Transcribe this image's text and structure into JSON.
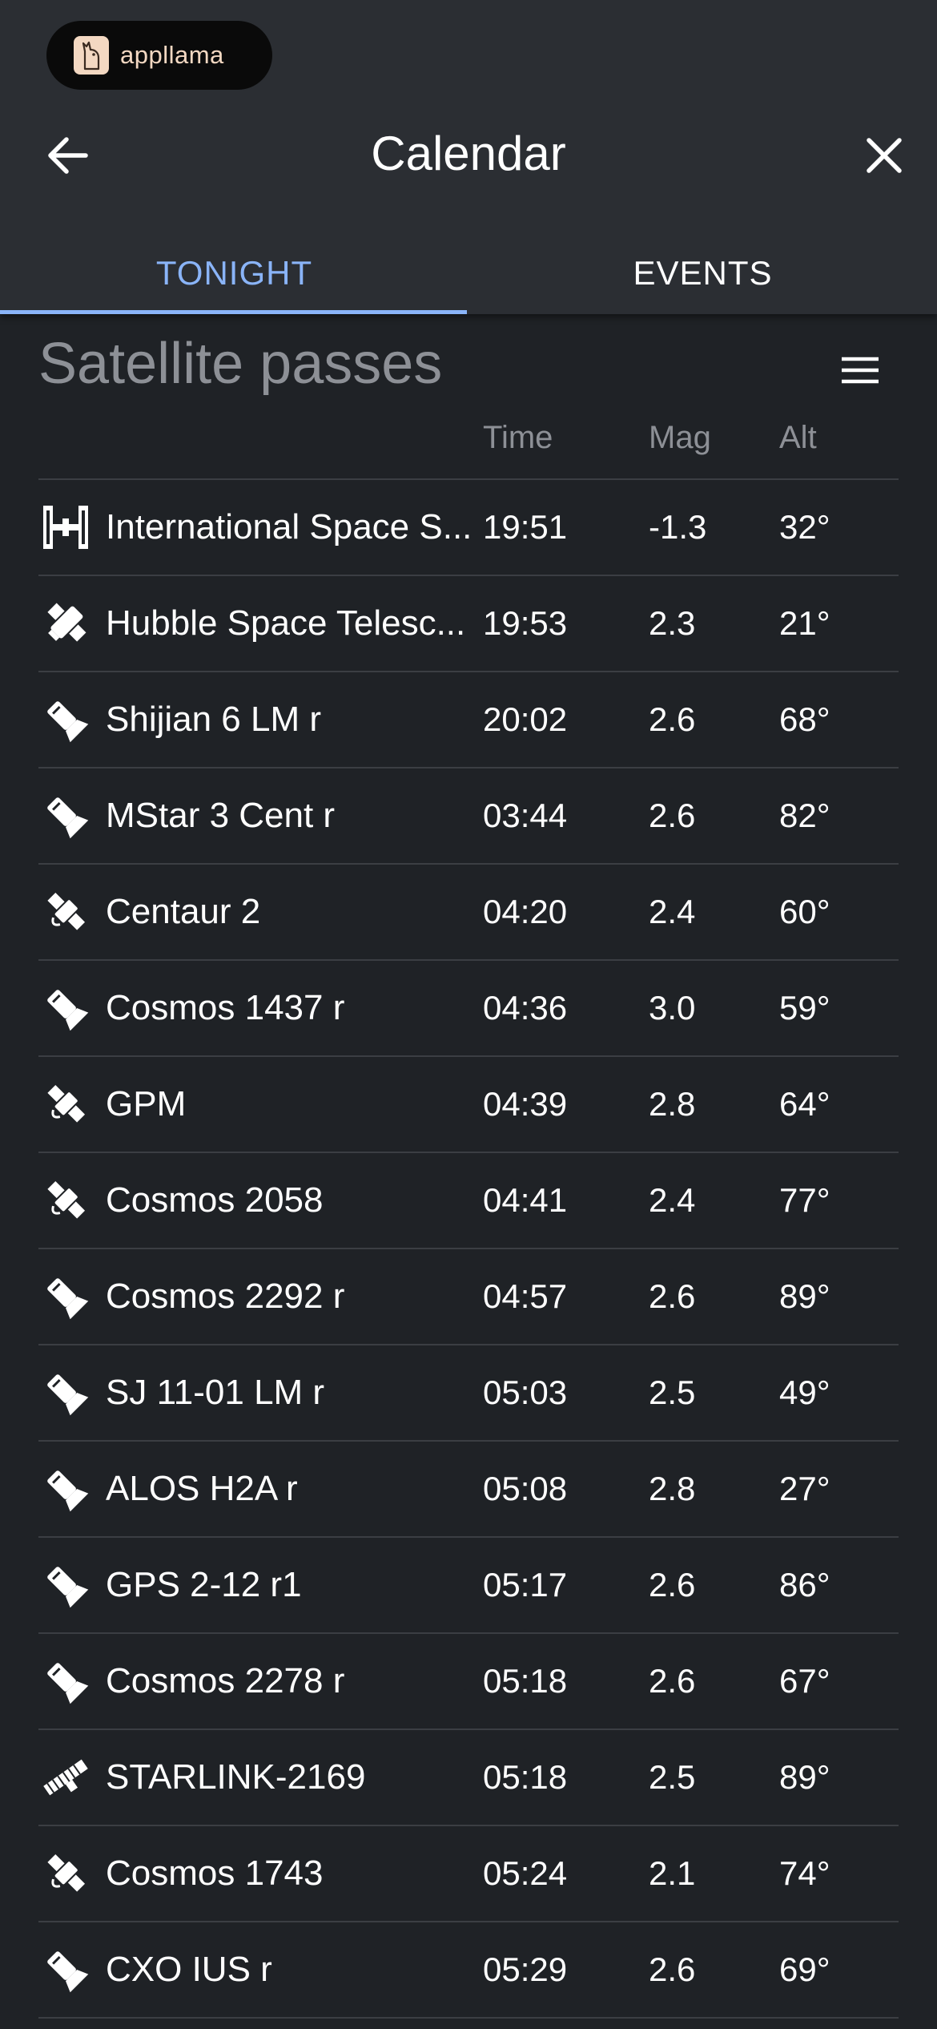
{
  "badge": {
    "text": "appllama"
  },
  "header": {
    "title": "Calendar"
  },
  "tabs": [
    {
      "label": "TONIGHT",
      "active": true
    },
    {
      "label": "EVENTS",
      "active": false
    }
  ],
  "section": {
    "title": "Satellite passes"
  },
  "columns": {
    "time": "Time",
    "mag": "Mag",
    "alt": "Alt"
  },
  "colors": {
    "accent": "#8ab4f8",
    "background": "#1f2226",
    "header": "#2b2e33",
    "muted_text": "#8d9096"
  },
  "passes": [
    {
      "icon": "space-station-icon",
      "name": "International Space S...",
      "time": "19:51",
      "mag": "-1.3",
      "alt": "32°"
    },
    {
      "icon": "telescope-satellite-icon",
      "name": "Hubble Space Telesc...",
      "time": "19:53",
      "mag": "2.3",
      "alt": "21°"
    },
    {
      "icon": "rocket-body-icon",
      "name": "Shijian 6 LM r",
      "time": "20:02",
      "mag": "2.6",
      "alt": "68°"
    },
    {
      "icon": "rocket-body-icon",
      "name": "MStar 3 Cent r",
      "time": "03:44",
      "mag": "2.6",
      "alt": "82°"
    },
    {
      "icon": "satellite-icon",
      "name": "Centaur 2",
      "time": "04:20",
      "mag": "2.4",
      "alt": "60°"
    },
    {
      "icon": "rocket-body-icon",
      "name": "Cosmos 1437 r",
      "time": "04:36",
      "mag": "3.0",
      "alt": "59°"
    },
    {
      "icon": "satellite-icon",
      "name": "GPM",
      "time": "04:39",
      "mag": "2.8",
      "alt": "64°"
    },
    {
      "icon": "satellite-icon",
      "name": "Cosmos 2058",
      "time": "04:41",
      "mag": "2.4",
      "alt": "77°"
    },
    {
      "icon": "rocket-body-icon",
      "name": "Cosmos 2292 r",
      "time": "04:57",
      "mag": "2.6",
      "alt": "89°"
    },
    {
      "icon": "rocket-body-icon",
      "name": "SJ 11-01 LM r",
      "time": "05:03",
      "mag": "2.5",
      "alt": "49°"
    },
    {
      "icon": "rocket-body-icon",
      "name": "ALOS H2A r",
      "time": "05:08",
      "mag": "2.8",
      "alt": "27°"
    },
    {
      "icon": "rocket-body-icon",
      "name": "GPS 2-12 r1",
      "time": "05:17",
      "mag": "2.6",
      "alt": "86°"
    },
    {
      "icon": "rocket-body-icon",
      "name": "Cosmos 2278 r",
      "time": "05:18",
      "mag": "2.6",
      "alt": "67°"
    },
    {
      "icon": "starlink-icon",
      "name": "STARLINK-2169",
      "time": "05:18",
      "mag": "2.5",
      "alt": "89°"
    },
    {
      "icon": "satellite-icon",
      "name": "Cosmos 1743",
      "time": "05:24",
      "mag": "2.1",
      "alt": "74°"
    },
    {
      "icon": "rocket-body-icon",
      "name": "CXO IUS r",
      "time": "05:29",
      "mag": "2.6",
      "alt": "69°"
    }
  ]
}
